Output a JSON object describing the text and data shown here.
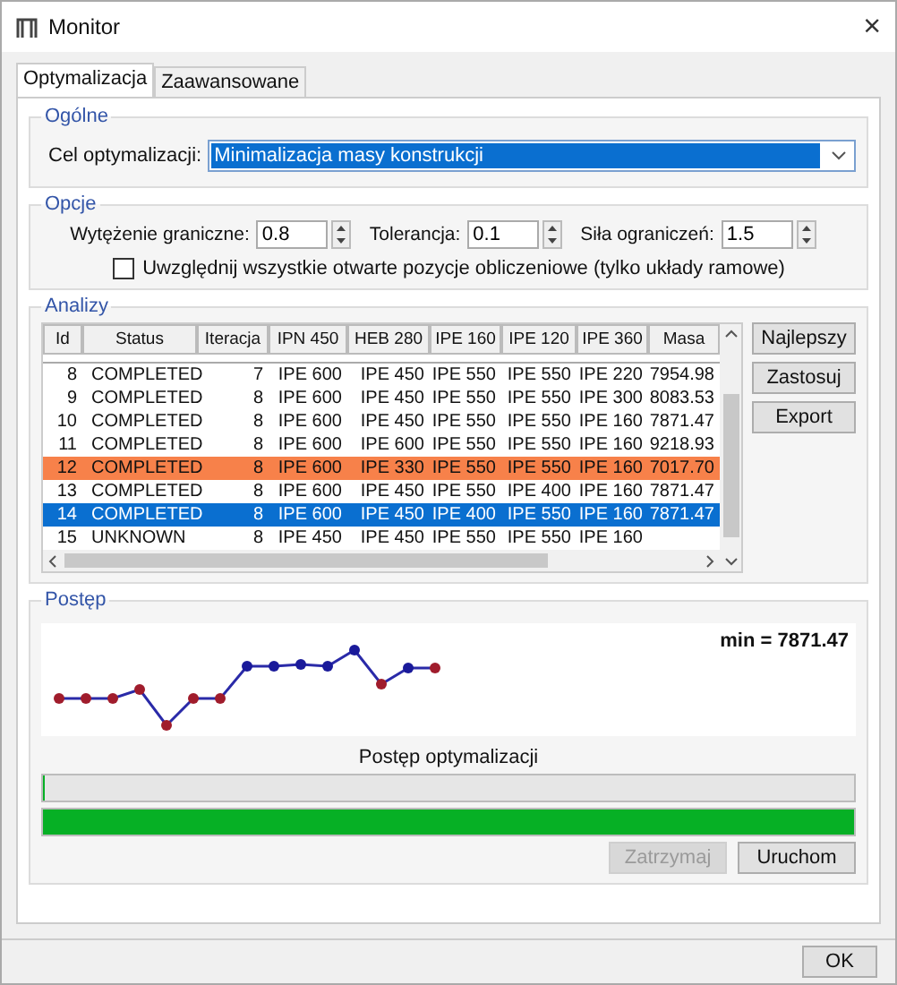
{
  "window": {
    "title": "Monitor",
    "close": "×"
  },
  "tabs": [
    {
      "label": "Optymalizacja",
      "selected": true
    },
    {
      "label": "Zaawansowane",
      "selected": false
    }
  ],
  "general": {
    "title": "Ogólne",
    "goal_label": "Cel optymalizacji:",
    "goal_value": "Minimalizacja masy konstrukcji"
  },
  "options": {
    "title": "Opcje",
    "fields": [
      {
        "label": "Wytężenie graniczne:",
        "value": "0.8"
      },
      {
        "label": "Tolerancja:",
        "value": "0.1"
      },
      {
        "label": "Siła ograniczeń:",
        "value": "1.5"
      }
    ],
    "checkbox": {
      "label": "Uwzględnij wszystkie otwarte pozycje obliczeniowe (tylko układy ramowe)",
      "checked": false
    }
  },
  "analyses": {
    "title": "Analizy",
    "columns": [
      "Id",
      "Status",
      "Iteracja",
      "IPN 450",
      "HEB 280",
      "IPE 160",
      "IPE 120",
      "IPE 360",
      "Masa"
    ],
    "rows": [
      {
        "cells": [
          "8",
          "COMPLETED",
          "7",
          "IPE 600",
          "IPE 450",
          "IPE 550",
          "IPE 550",
          "IPE 220",
          "7954.98"
        ],
        "best": false,
        "selected": false
      },
      {
        "cells": [
          "9",
          "COMPLETED",
          "8",
          "IPE 600",
          "IPE 450",
          "IPE 550",
          "IPE 550",
          "IPE 300",
          "8083.53"
        ],
        "best": false,
        "selected": false
      },
      {
        "cells": [
          "10",
          "COMPLETED",
          "8",
          "IPE 600",
          "IPE 450",
          "IPE 550",
          "IPE 550",
          "IPE 160",
          "7871.47"
        ],
        "best": false,
        "selected": false
      },
      {
        "cells": [
          "11",
          "COMPLETED",
          "8",
          "IPE 600",
          "IPE 600",
          "IPE 550",
          "IPE 550",
          "IPE 160",
          "9218.93"
        ],
        "best": false,
        "selected": false
      },
      {
        "cells": [
          "12",
          "COMPLETED",
          "8",
          "IPE 600",
          "IPE 330",
          "IPE 550",
          "IPE 550",
          "IPE 160",
          "7017.70"
        ],
        "best": true,
        "selected": false
      },
      {
        "cells": [
          "13",
          "COMPLETED",
          "8",
          "IPE 600",
          "IPE 450",
          "IPE 550",
          "IPE 400",
          "IPE 160",
          "7871.47"
        ],
        "best": false,
        "selected": false
      },
      {
        "cells": [
          "14",
          "COMPLETED",
          "8",
          "IPE 600",
          "IPE 450",
          "IPE 400",
          "IPE 550",
          "IPE 160",
          "7871.47"
        ],
        "best": false,
        "selected": true
      },
      {
        "cells": [
          "15",
          "UNKNOWN",
          "8",
          "IPE 450",
          "IPE 450",
          "IPE 550",
          "IPE 550",
          "IPE 160",
          ""
        ],
        "best": false,
        "selected": false
      }
    ],
    "buttons": [
      "Najlepszy",
      "Zastosuj",
      "Export"
    ]
  },
  "progress": {
    "title": "Postęp",
    "min_label": "min = 7871.47",
    "caption": "Postęp optymalizacji",
    "bars": [
      {
        "level": 0
      },
      {
        "level": 1
      }
    ],
    "buttons": [
      {
        "label": "Zatrzymaj",
        "disabled": true
      },
      {
        "label": "Uruchom",
        "disabled": false
      }
    ]
  },
  "footer": {
    "ok": "OK"
  }
}
